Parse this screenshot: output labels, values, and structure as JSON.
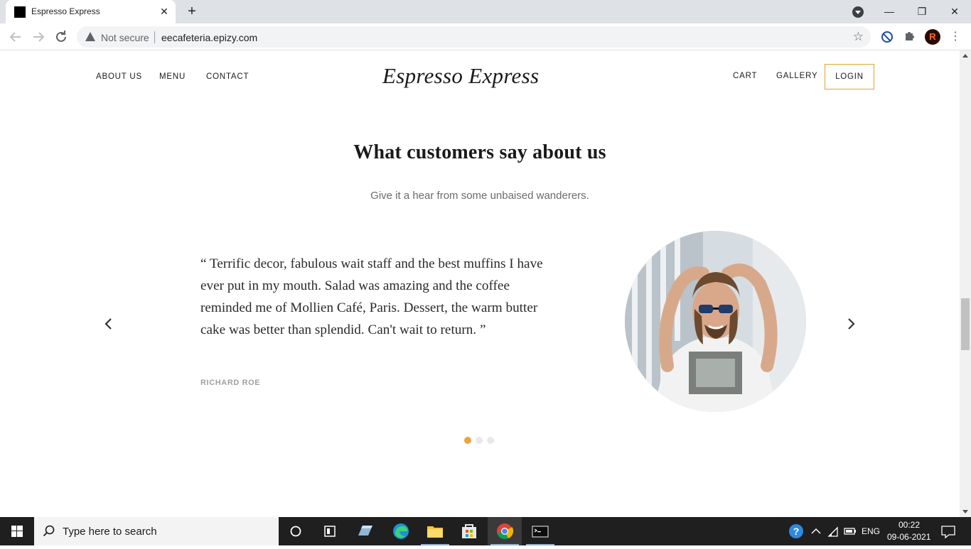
{
  "browser": {
    "tab_title": "Espresso Express",
    "tab_close": "✕",
    "new_tab": "+",
    "security_label": "Not secure",
    "url": "eecafeteria.epizy.com",
    "window_controls": {
      "minimize": "—",
      "restore": "❐",
      "close": "✕"
    },
    "avatar_letter": "R"
  },
  "site": {
    "nav_left": [
      "ABOUT US",
      "MENU",
      "CONTACT"
    ],
    "logo": "Espresso Express",
    "nav_right": [
      "CART",
      "GALLERY"
    ],
    "login": "LOGIN"
  },
  "testimonials": {
    "title": "What customers say about us",
    "subtitle": "Give it a hear from some unbaised wanderers.",
    "quote": "“ Terrific decor, fabulous wait staff and the best muffins I have ever put in my mouth. Salad was amazing and the coffee reminded me of Mollien Café, Paris. Dessert, the warm butter cake was better than splendid. Can't wait to return. ”",
    "author": "RICHARD ROE",
    "slide_count": 3,
    "active_slide": 1,
    "accent_color": "#f0a33b"
  },
  "taskbar": {
    "search_placeholder": "Type here to search",
    "language": "ENG",
    "time": "00:22",
    "date": "09-06-2021"
  }
}
